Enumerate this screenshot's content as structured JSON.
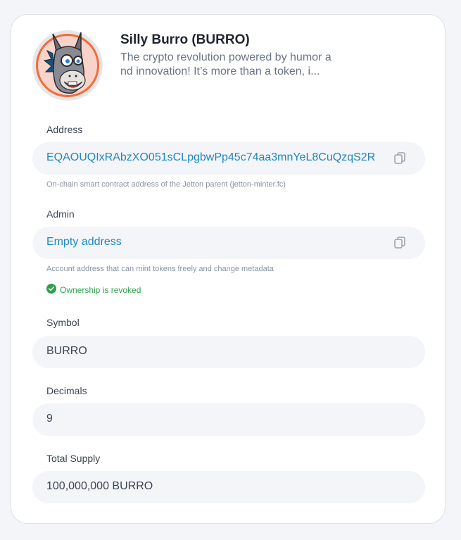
{
  "token": {
    "name": "Silly Burro (BURRO)",
    "description": "The crypto revolution powered by humor and innovation! It’s more than a token, i..."
  },
  "address": {
    "label": "Address",
    "value": "EQAOUQIxRAbzXO051sCLpgbwPp45c74aa3mnYeL8CuQzqS2R",
    "hint": "On-chain smart contract address of the Jetton parent (jetton-minter.fc)"
  },
  "admin": {
    "label": "Admin",
    "value": "Empty address",
    "hint": "Account address that can mint tokens freely and change metadata",
    "status": "Ownership is revoked"
  },
  "symbol": {
    "label": "Symbol",
    "value": "BURRO"
  },
  "decimals": {
    "label": "Decimals",
    "value": "9"
  },
  "supply": {
    "label": "Total Supply",
    "value": "100,000,000 BURRO"
  },
  "colors": {
    "link": "#2086c2",
    "success": "#2ba24c",
    "field_bg": "#f3f5f8",
    "avatar_ring": "#f26b3a"
  },
  "icons": [
    "avatar-image",
    "copy-icon",
    "check-circle-icon"
  ]
}
